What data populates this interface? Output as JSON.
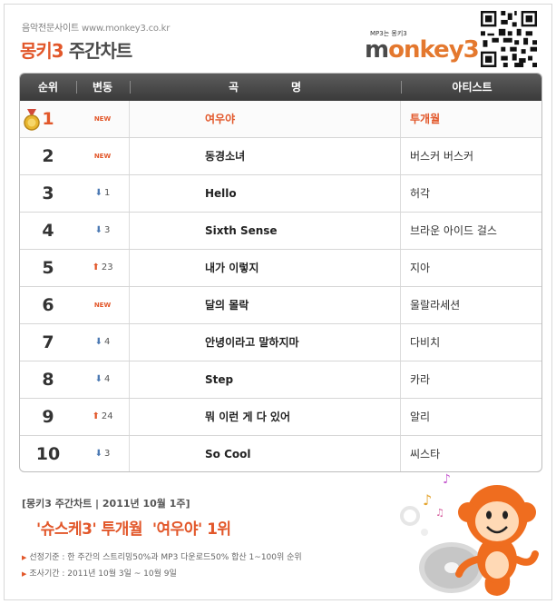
{
  "header": {
    "site_label": "음악전문사이트",
    "site_url": "www.monkey3.co.kr",
    "title_brand": "몽키3",
    "title_rest": "주간차트",
    "logo_tagline": "MP3는 몽키3",
    "logo_word_prefix": "m",
    "logo_word_rest": "onkey3"
  },
  "table": {
    "columns": [
      "순위",
      "변동",
      "곡명",
      "아티스트"
    ],
    "rows": [
      {
        "rank": "1",
        "change_type": "new",
        "change": "NEW",
        "song": "여우야",
        "artist": "투개월"
      },
      {
        "rank": "2",
        "change_type": "new",
        "change": "NEW",
        "song": "동경소녀",
        "artist": "버스커 버스커"
      },
      {
        "rank": "3",
        "change_type": "down",
        "change": "1",
        "song": "Hello",
        "artist": "허각"
      },
      {
        "rank": "4",
        "change_type": "down",
        "change": "3",
        "song": "Sixth Sense",
        "artist": "브라운 아이드 걸스"
      },
      {
        "rank": "5",
        "change_type": "up",
        "change": "23",
        "song": "내가 이렇지",
        "artist": "지아"
      },
      {
        "rank": "6",
        "change_type": "new",
        "change": "NEW",
        "song": "달의 몰락",
        "artist": "울랄라세션"
      },
      {
        "rank": "7",
        "change_type": "down",
        "change": "4",
        "song": "안녕이라고 말하지마",
        "artist": "다비치"
      },
      {
        "rank": "8",
        "change_type": "down",
        "change": "4",
        "song": "Step",
        "artist": "카라"
      },
      {
        "rank": "9",
        "change_type": "up",
        "change": "24",
        "song": "뭐 이런 게 다 있어",
        "artist": "알리"
      },
      {
        "rank": "10",
        "change_type": "down",
        "change": "3",
        "song": "So Cool",
        "artist": "씨스타"
      }
    ]
  },
  "footer": {
    "chart_label": "[몽키3 주간차트 | 2011년 10월 1주]",
    "headline": "'슈스케3' 투개월  '여우야' 1위",
    "note1": "선정기준 : 한 주간의 스트리밍50%과 MP3 다운로드50% 합산 1~100위 순위",
    "note2": "조사기간 : 2011년 10월 3일 ~ 10월 9일"
  },
  "icons": {
    "medal": "gold-medal-icon",
    "down": "down-arrow-icon",
    "up": "up-arrow-icon",
    "qr": "qr-code-icon",
    "mascot": "monkey-mascot-icon"
  },
  "colors": {
    "accent": "#e2572a",
    "down": "#4b79b3",
    "header_bg": "#4a4a4a"
  }
}
